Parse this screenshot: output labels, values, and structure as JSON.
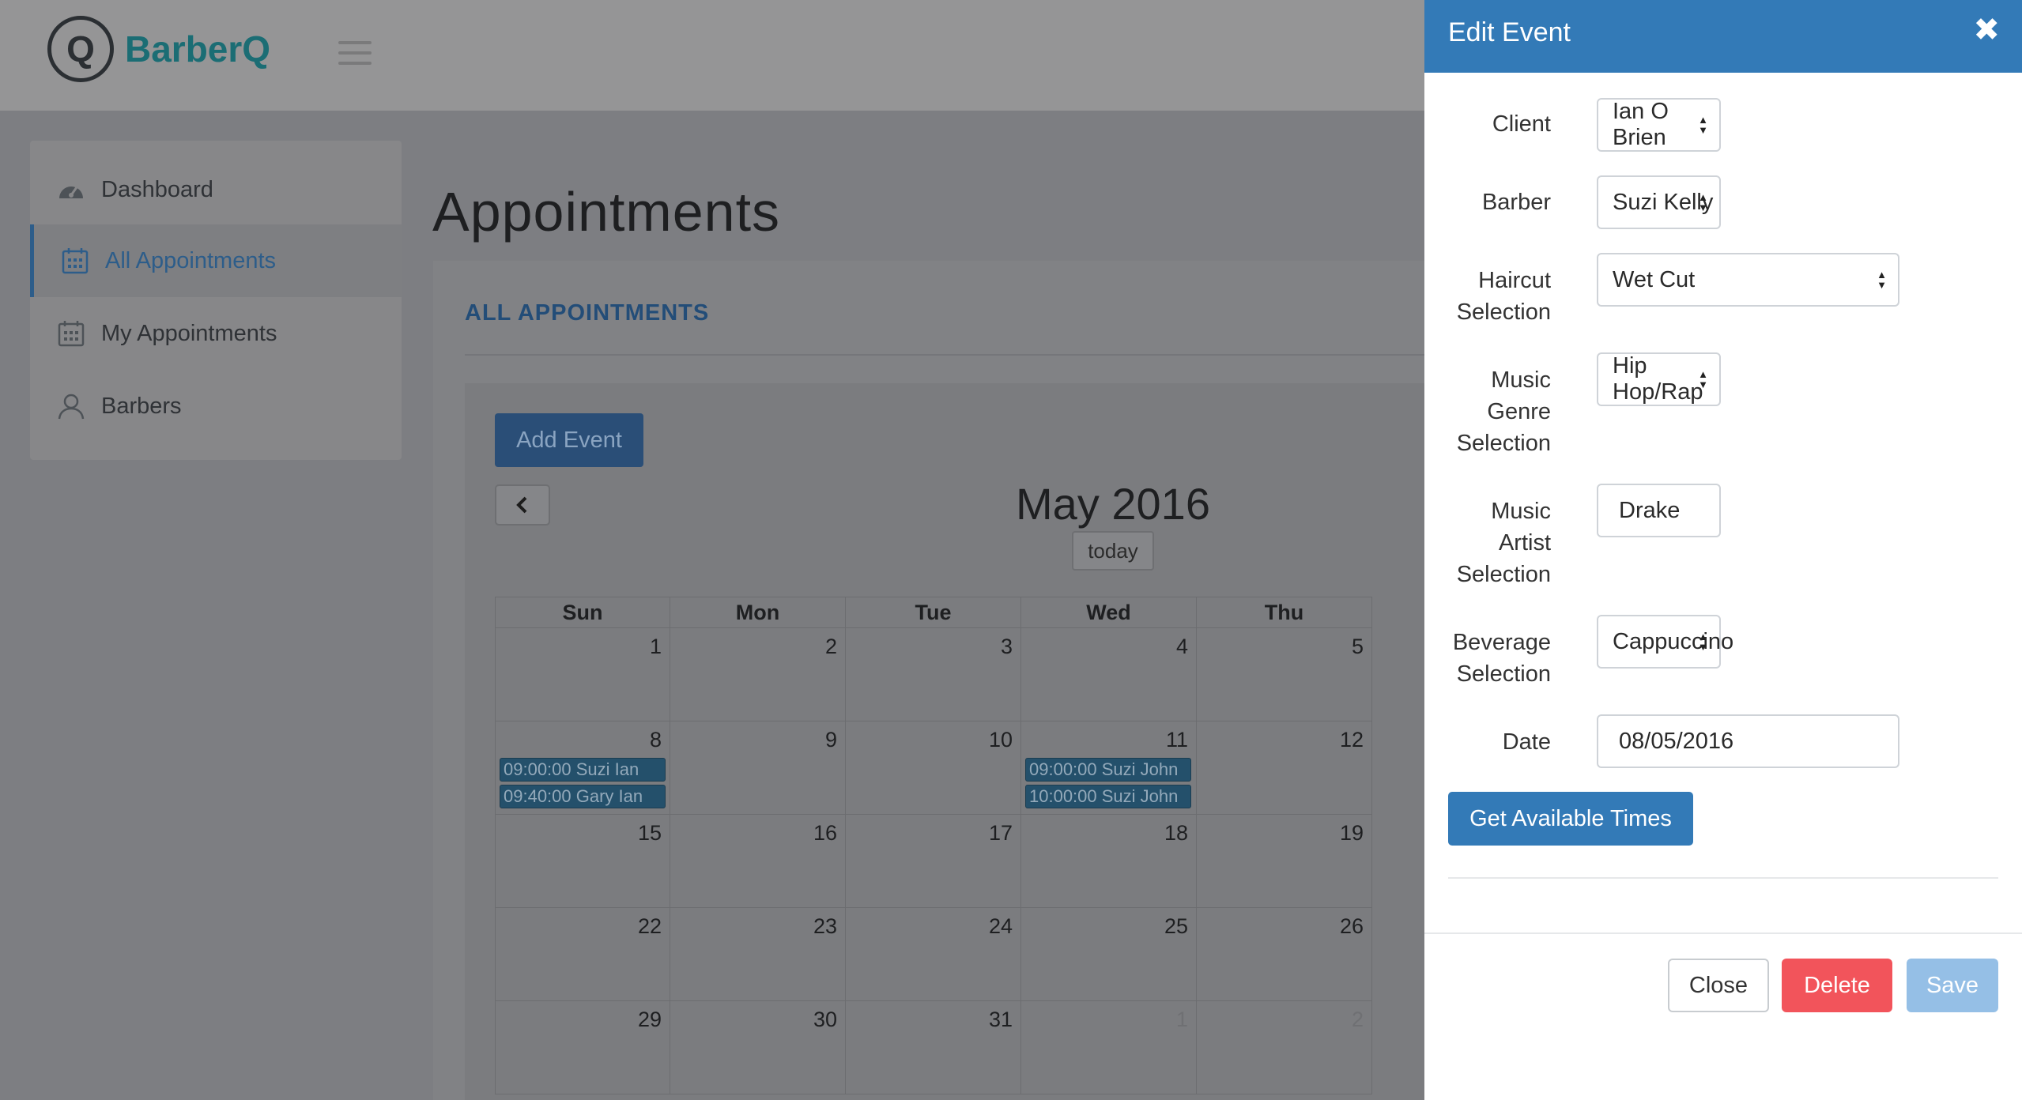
{
  "app": {
    "logo_letter": "Q",
    "name": "BarberQ"
  },
  "sidebar": {
    "items": [
      {
        "label": "Dashboard",
        "icon": "dashboard-icon",
        "active": false
      },
      {
        "label": "All Appointments",
        "icon": "calendar-icon",
        "active": true
      },
      {
        "label": "My Appointments",
        "icon": "calendar-icon",
        "active": false
      },
      {
        "label": "Barbers",
        "icon": "user-icon",
        "active": false
      }
    ]
  },
  "page": {
    "title": "Appointments"
  },
  "panel": {
    "title": "ALL APPOINTMENTS"
  },
  "calendar": {
    "add_event_label": "Add Event",
    "prev_glyph": "‹",
    "month_title": "May 2016",
    "today_label": "today",
    "weekdays": [
      "Sun",
      "Mon",
      "Tue",
      "Wed",
      "Thu"
    ],
    "weeks": [
      {
        "days": [
          {
            "n": "1"
          },
          {
            "n": "2"
          },
          {
            "n": "3"
          },
          {
            "n": "4"
          },
          {
            "n": "5"
          }
        ]
      },
      {
        "days": [
          {
            "n": "8",
            "events": [
              "09:00:00 Suzi Ian",
              "09:40:00 Gary Ian"
            ]
          },
          {
            "n": "9"
          },
          {
            "n": "10"
          },
          {
            "n": "11",
            "events": [
              "09:00:00 Suzi John",
              "10:00:00 Suzi John"
            ]
          },
          {
            "n": "12"
          }
        ]
      },
      {
        "days": [
          {
            "n": "15"
          },
          {
            "n": "16"
          },
          {
            "n": "17"
          },
          {
            "n": "18"
          },
          {
            "n": "19"
          }
        ]
      },
      {
        "days": [
          {
            "n": "22"
          },
          {
            "n": "23"
          },
          {
            "n": "24"
          },
          {
            "n": "25"
          },
          {
            "n": "26"
          }
        ]
      },
      {
        "days": [
          {
            "n": "29"
          },
          {
            "n": "30"
          },
          {
            "n": "31"
          },
          {
            "n": "1",
            "other": true
          },
          {
            "n": "2",
            "other": true
          }
        ]
      }
    ]
  },
  "modal": {
    "title": "Edit Event",
    "close_glyph": "✖",
    "fields": {
      "client": {
        "label": "Client",
        "value": "Ian O Brien"
      },
      "barber": {
        "label": "Barber",
        "value": "Suzi Kelly"
      },
      "haircut": {
        "label_lines": [
          "Haircut",
          "Selection"
        ],
        "value": "Wet Cut"
      },
      "genre": {
        "label_lines": [
          "Music",
          "Genre",
          "Selection"
        ],
        "value": "Hip Hop/Rap"
      },
      "artist": {
        "label_lines": [
          "Music",
          "Artist",
          "Selection"
        ],
        "value": "Drake"
      },
      "beverage": {
        "label_lines": [
          "Beverage",
          "Selection"
        ],
        "value": "Cappuccino"
      },
      "date": {
        "label": "Date",
        "value": "08/05/2016"
      }
    },
    "get_times_label": "Get Available Times",
    "footer": {
      "close_label": "Close",
      "delete_label": "Delete",
      "save_label": "Save"
    }
  },
  "colors": {
    "primary": "#337ab7",
    "danger": "#f2545b",
    "brand": "#1b6d74"
  }
}
